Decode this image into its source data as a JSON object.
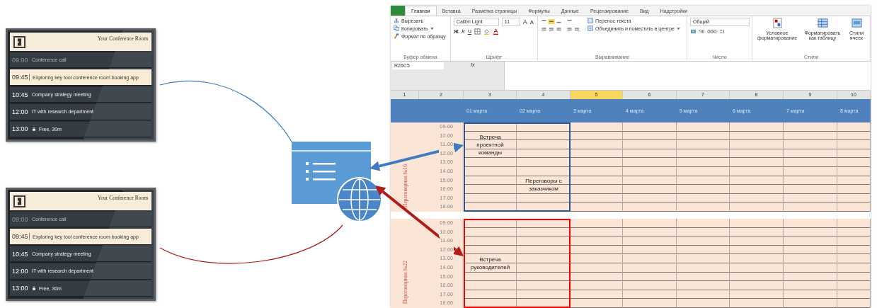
{
  "tablets": [
    {
      "room_name": "Your Conference Room",
      "rows": [
        {
          "time": "09:00",
          "title": "Conference call",
          "past": true,
          "current": false,
          "locked": false
        },
        {
          "time": "09:45",
          "title": "Exploring key tool conference room booking app",
          "past": false,
          "current": true,
          "locked": false
        },
        {
          "time": "10:45",
          "title": "Company strategy meeting",
          "past": false,
          "current": false,
          "locked": false
        },
        {
          "time": "12:00",
          "title": "IT with research department",
          "past": false,
          "current": false,
          "locked": false
        },
        {
          "time": "13:00",
          "title": "Free, 30m",
          "past": false,
          "current": false,
          "locked": true
        }
      ]
    },
    {
      "room_name": "Your Conference Room",
      "rows": [
        {
          "time": "09:00",
          "title": "Conference call",
          "past": true,
          "current": false,
          "locked": false
        },
        {
          "time": "09:45",
          "title": "Exploring key tool conference room booking app",
          "past": false,
          "current": true,
          "locked": false
        },
        {
          "time": "10:45",
          "title": "Company strategy meeting",
          "past": false,
          "current": false,
          "locked": false
        },
        {
          "time": "12:00",
          "title": "IT with research department",
          "past": false,
          "current": false,
          "locked": false
        },
        {
          "time": "13:00",
          "title": "Free, 30m",
          "past": false,
          "current": false,
          "locked": true
        }
      ]
    }
  ],
  "links": [
    {
      "color": "#3d7cc0"
    },
    {
      "color": "#b31b1b"
    }
  ],
  "excel": {
    "ribbon_tabs": [
      {
        "label": "Главная",
        "selected": true
      },
      {
        "label": "Вставка",
        "selected": false
      },
      {
        "label": "Разметка страницы",
        "selected": false
      },
      {
        "label": "Формулы",
        "selected": false
      },
      {
        "label": "Данные",
        "selected": false
      },
      {
        "label": "Рецензирование",
        "selected": false
      },
      {
        "label": "Вид",
        "selected": false
      },
      {
        "label": "Надстройки",
        "selected": false
      }
    ],
    "clipboard": {
      "cut": "Вырезать",
      "copy": "Копировать",
      "format_painter": "Формат по образцу",
      "label": "Буфер обмена"
    },
    "font": {
      "name": "Calibri Light",
      "size": "11",
      "grow": "A",
      "shrink": "A",
      "bold": "Ж",
      "italic": "К",
      "underline": "Ч",
      "label": "Шрифт"
    },
    "alignment": {
      "wrap": "Перенос текста",
      "merge": "Объединить и поместить в центре",
      "label": "Выравнивание"
    },
    "number": {
      "format": "Общий",
      "percent": "%",
      "thousands": "000",
      "label": "Число"
    },
    "styles": {
      "conditional": "Условное форматирование",
      "table": "Форматировать как таблицу",
      "cell": "Стили ячеек",
      "label": "Стили"
    },
    "name_box": "R26C5",
    "formula_label": "fx",
    "columns": [
      {
        "label": "1",
        "selected": false
      },
      {
        "label": "2",
        "selected": false
      },
      {
        "label": "3",
        "selected": false
      },
      {
        "label": "4",
        "selected": false
      },
      {
        "label": "5",
        "selected": true
      },
      {
        "label": "6",
        "selected": false
      },
      {
        "label": "7",
        "selected": false
      },
      {
        "label": "8",
        "selected": false
      },
      {
        "label": "9",
        "selected": false
      },
      {
        "label": "10",
        "selected": false
      }
    ],
    "dates": [
      "01 марта",
      "02 марта",
      "3 марта",
      "4 марта",
      "5 марта",
      "6 марта",
      "7 марта",
      "8 марта"
    ],
    "rooms": [
      {
        "name": "Переговорная №16",
        "color": "#2f5597",
        "times": [
          "09.00",
          "10.00",
          "11.00",
          "12.00",
          "13.00",
          "14.00",
          "15.00",
          "16.00",
          "17.00",
          "18.00"
        ],
        "events": [
          {
            "text": "Встреча проектной команды"
          },
          {
            "text": "Переговоры с заказчиком"
          }
        ]
      },
      {
        "name": "Переговорная №22",
        "color": "#ff0000",
        "times": [
          "09.00",
          "10.00",
          "11.00",
          "12.00",
          "13.00",
          "14.00",
          "15.00",
          "16.00",
          "17.00",
          "18.00"
        ],
        "events": [
          {
            "text": "Встреча руководителей"
          }
        ]
      }
    ]
  }
}
